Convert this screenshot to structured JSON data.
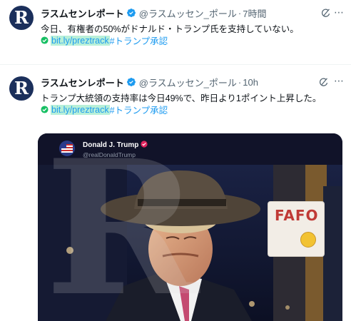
{
  "tweets": [
    {
      "avatar_letter": "R",
      "name": "ラスムセンレポート",
      "handle": "@ラスムッセン_ポール",
      "separator": "·",
      "time": "7時間",
      "text": "今日、有権者の50%がドナルド・トランプ氏を支持していない。",
      "link": "bit.ly/preztrack",
      "hashtag": "#トランプ承認"
    },
    {
      "avatar_letter": "R",
      "name": "ラスムセンレポート",
      "handle": "@ラスムッセン_ポール",
      "separator": "·",
      "time": "10h",
      "text": "トランプ大統領の支持率は今日49%で、昨日より1ポイント上昇した。",
      "link": "bit.ly/preztrack",
      "hashtag": "#トランプ承認",
      "media": {
        "inner_name": "Donald J. Trump",
        "inner_handle": "@realDonaldTrump",
        "sign_text": "FAFO"
      }
    }
  ],
  "icons": {
    "verified": "verified-badge-icon",
    "grok": "grok-icon",
    "more": "more-icon",
    "check": "check-circle-icon"
  },
  "colors": {
    "accent": "#1d9bf0",
    "link_highlight": "#b8f0d8",
    "check_green": "#17bf63",
    "muted": "#536471"
  }
}
